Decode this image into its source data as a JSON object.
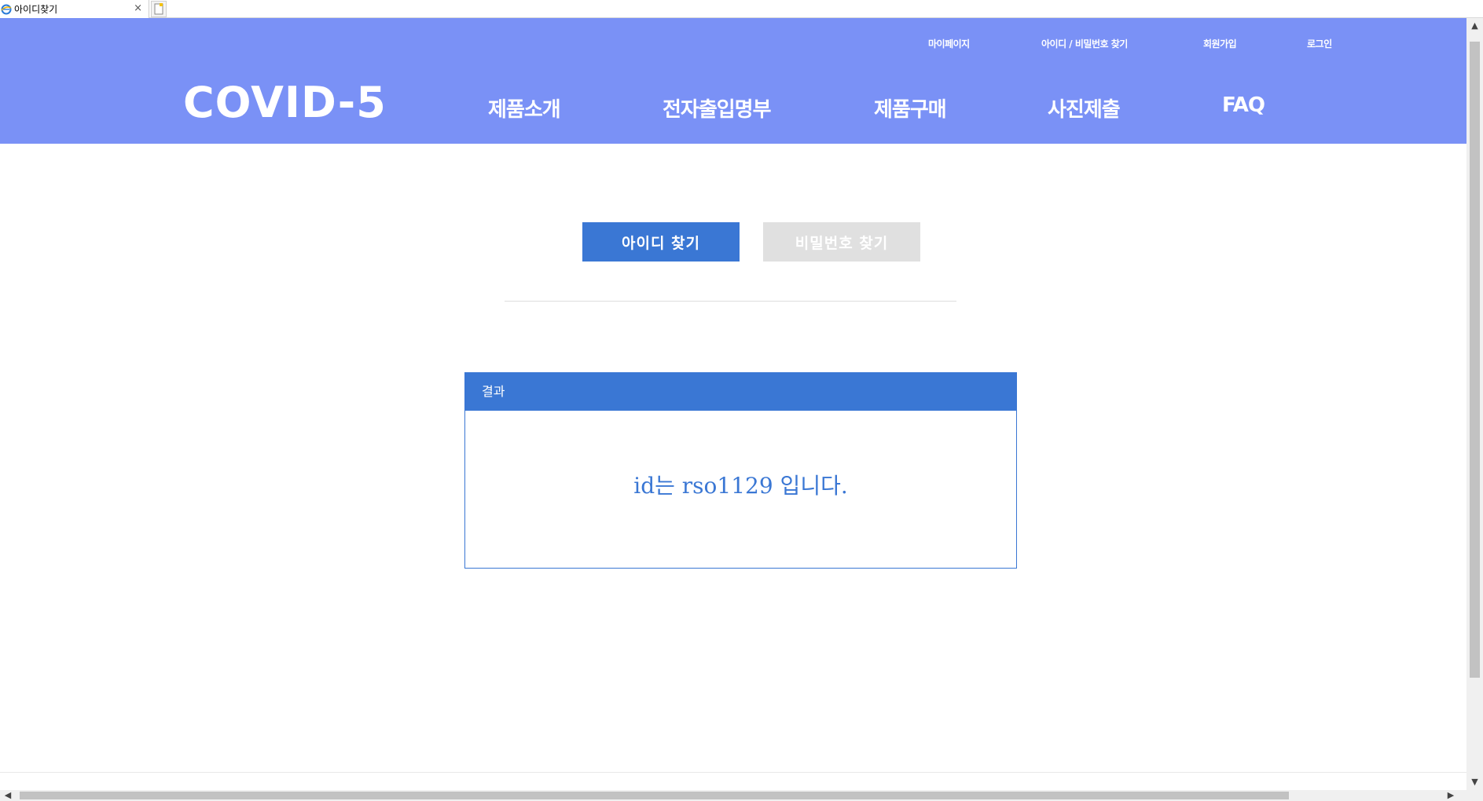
{
  "browser": {
    "tab_title": "아이디찾기",
    "close_symbol": "×"
  },
  "header": {
    "util_links": [
      "마이페이지",
      "아이디 / 비밀번호 찾기",
      "회원가입",
      "로그인"
    ],
    "logo": "COVID-5",
    "nav": [
      "제품소개",
      "전자출입명부",
      "제품구매",
      "사진제출",
      "FAQ"
    ],
    "background_color": "#7a91f6"
  },
  "tabs": {
    "find_id": "아이디 찾기",
    "find_pw": "비밀번호 찾기",
    "active": "find_id"
  },
  "result": {
    "heading": "결과",
    "message": "id는 rso1129 입니다."
  },
  "colors": {
    "accent": "#3a77d4",
    "inactive": "#e0e0e0"
  }
}
